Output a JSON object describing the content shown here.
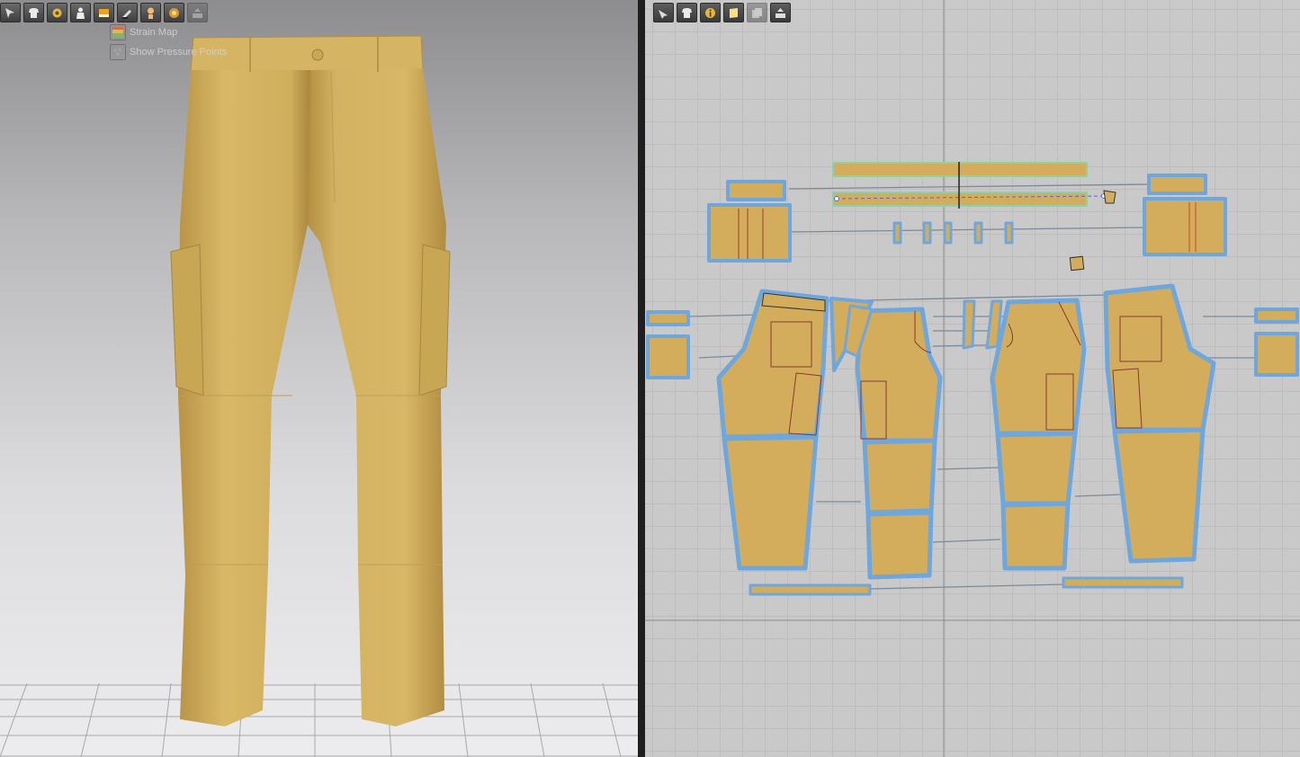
{
  "window": {
    "left_panel": "3D Garment Window",
    "right_panel": "2D Pattern Window"
  },
  "toolbar_3d": {
    "icons": [
      "select-mesh-icon",
      "garment-tool-icon",
      "fabric-settings-icon",
      "avatar-icon",
      "texture-icon",
      "edit-tool-icon",
      "skin-icon",
      "render-icon",
      "export-icon"
    ]
  },
  "popup_menu": {
    "strain_map": "Strain Map",
    "pressure_points": "Show Pressure Points"
  },
  "toolbar_2d": {
    "icons": [
      "edit-pattern-icon",
      "arrangement-icon",
      "info-icon",
      "fabric-view-icon",
      "copy-icon",
      "export-icon"
    ]
  },
  "colors": {
    "fabric": "#d4b15e",
    "fabric_dark": "#b89446",
    "pattern_fill": "#d4ad5c",
    "pattern_outline": "#6ea6de",
    "seam_line": "#7b8a99",
    "accent_toolbar": "#c99b2f"
  }
}
